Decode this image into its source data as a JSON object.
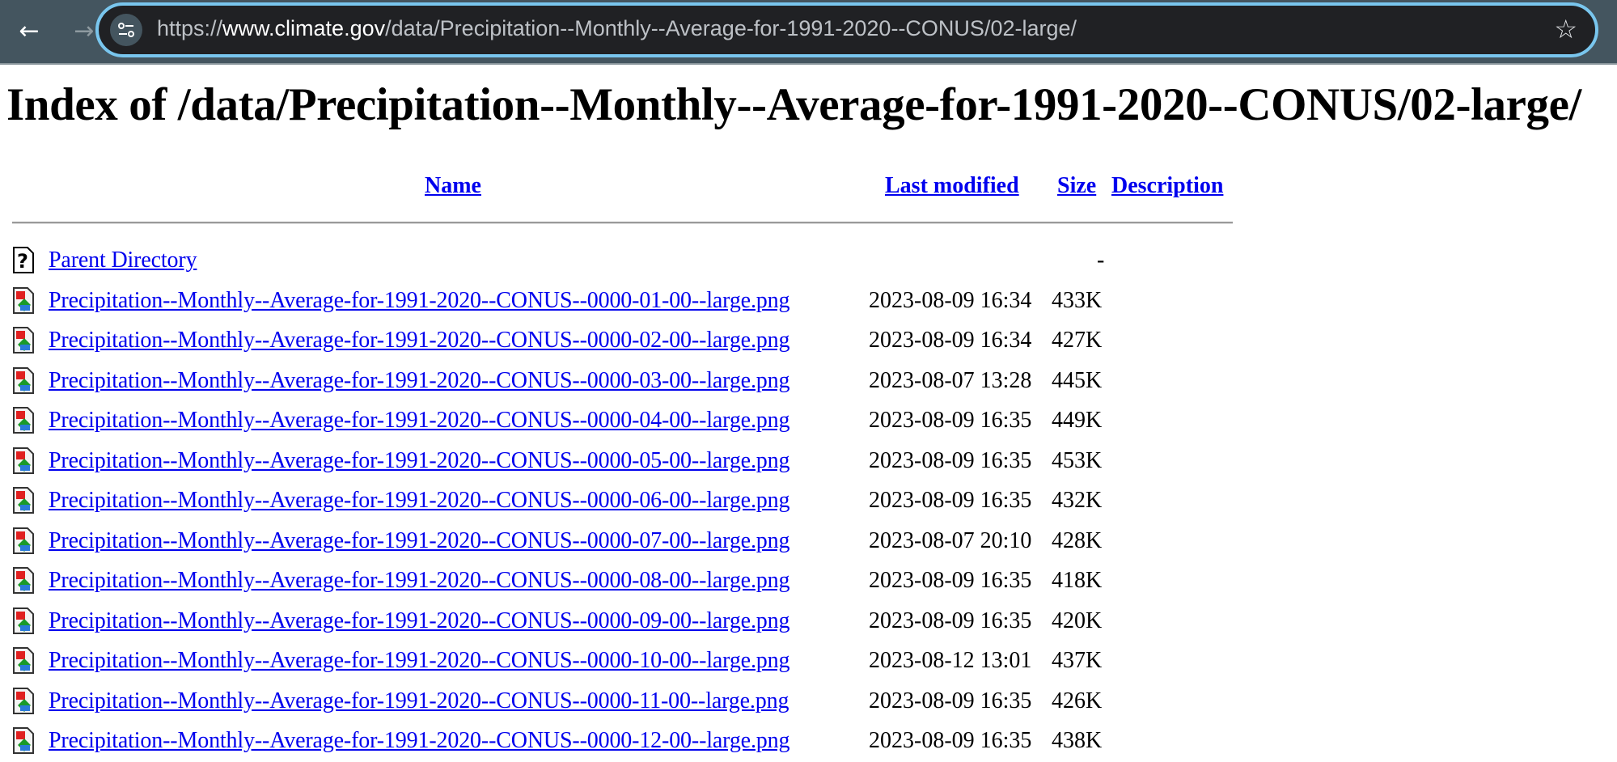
{
  "browser": {
    "url_prefix": "https://",
    "url_domain": "www.climate.gov",
    "url_path": "/data/Precipitation--Monthly--Average-for-1991-2020--CONUS/02-large/"
  },
  "page": {
    "title": "Index of /data/Precipitation--Monthly--Average-for-1991-2020--CONUS/02-large/",
    "columns": {
      "name": "Name",
      "last_modified": "Last modified",
      "size": "Size",
      "description": "Description"
    },
    "parent": {
      "label": "Parent Directory",
      "size": "-"
    },
    "files": [
      {
        "name": "Precipitation--Monthly--Average-for-1991-2020--CONUS--0000-01-00--large.png",
        "modified": "2023-08-09 16:34",
        "size": "433K"
      },
      {
        "name": "Precipitation--Monthly--Average-for-1991-2020--CONUS--0000-02-00--large.png",
        "modified": "2023-08-09 16:34",
        "size": "427K"
      },
      {
        "name": "Precipitation--Monthly--Average-for-1991-2020--CONUS--0000-03-00--large.png",
        "modified": "2023-08-07 13:28",
        "size": "445K"
      },
      {
        "name": "Precipitation--Monthly--Average-for-1991-2020--CONUS--0000-04-00--large.png",
        "modified": "2023-08-09 16:35",
        "size": "449K"
      },
      {
        "name": "Precipitation--Monthly--Average-for-1991-2020--CONUS--0000-05-00--large.png",
        "modified": "2023-08-09 16:35",
        "size": "453K"
      },
      {
        "name": "Precipitation--Monthly--Average-for-1991-2020--CONUS--0000-06-00--large.png",
        "modified": "2023-08-09 16:35",
        "size": "432K"
      },
      {
        "name": "Precipitation--Monthly--Average-for-1991-2020--CONUS--0000-07-00--large.png",
        "modified": "2023-08-07 20:10",
        "size": "428K"
      },
      {
        "name": "Precipitation--Monthly--Average-for-1991-2020--CONUS--0000-08-00--large.png",
        "modified": "2023-08-09 16:35",
        "size": "418K"
      },
      {
        "name": "Precipitation--Monthly--Average-for-1991-2020--CONUS--0000-09-00--large.png",
        "modified": "2023-08-09 16:35",
        "size": "420K"
      },
      {
        "name": "Precipitation--Monthly--Average-for-1991-2020--CONUS--0000-10-00--large.png",
        "modified": "2023-08-12 13:01",
        "size": "437K"
      },
      {
        "name": "Precipitation--Monthly--Average-for-1991-2020--CONUS--0000-11-00--large.png",
        "modified": "2023-08-09 16:35",
        "size": "426K"
      },
      {
        "name": "Precipitation--Monthly--Average-for-1991-2020--CONUS--0000-12-00--large.png",
        "modified": "2023-08-09 16:35",
        "size": "438K"
      }
    ]
  },
  "icons": {
    "back": "arrow-left-icon",
    "forward": "arrow-right-icon",
    "reload": "reload-icon",
    "site_info": "tune-icon",
    "bookmark": "star-icon",
    "parent": "question-mark-icon",
    "file": "image-file-icon"
  },
  "colors": {
    "link": "#0000ee",
    "toolbar": "#44555f",
    "omnibox_border": "#79c6ee"
  }
}
